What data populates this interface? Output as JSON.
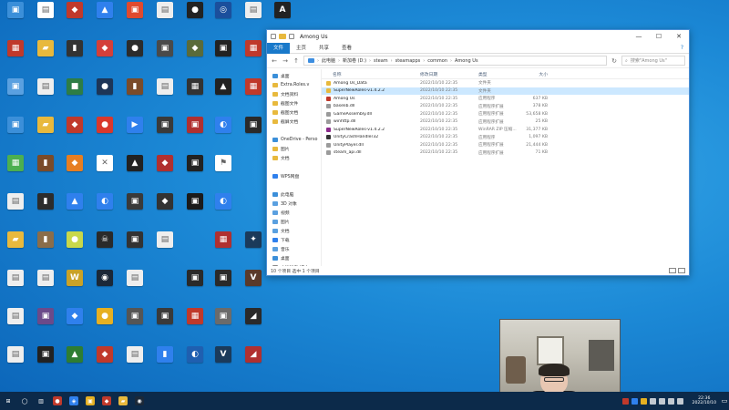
{
  "desktop": {
    "icons": [
      {
        "label": "",
        "color": "#3b8fd9",
        "glyph": "▣"
      },
      {
        "label": "",
        "color": "#ffffff",
        "glyph": "▤"
      },
      {
        "label": "",
        "color": "#c0392b",
        "glyph": "◆"
      },
      {
        "label": "",
        "color": "#2f80ed",
        "glyph": "▲"
      },
      {
        "label": "",
        "color": "#e04a2f",
        "glyph": "▣"
      },
      {
        "label": "",
        "color": "#eeeeee",
        "glyph": "▤"
      },
      {
        "label": "",
        "color": "#222222",
        "glyph": "●"
      },
      {
        "label": "",
        "color": "#1b4f9c",
        "glyph": "◎"
      },
      {
        "label": "",
        "color": "#eeeeee",
        "glyph": "▤"
      },
      {
        "label": "",
        "color": "#222222",
        "glyph": "A"
      },
      {
        "label": "",
        "color": "#c0392b",
        "glyph": "▦"
      },
      {
        "label": "",
        "color": "#e8b93d",
        "glyph": "▰"
      },
      {
        "label": "",
        "color": "#333333",
        "glyph": "▮"
      },
      {
        "label": "",
        "color": "#d43f3a",
        "glyph": "◆"
      },
      {
        "label": "",
        "color": "#2c2c2c",
        "glyph": "●"
      },
      {
        "label": "",
        "color": "#4a4a4a",
        "glyph": "▣"
      },
      {
        "label": "",
        "color": "#5a6b3a",
        "glyph": "◆"
      },
      {
        "label": "",
        "color": "#222222",
        "glyph": "▣"
      },
      {
        "label": "",
        "color": "#c0392b",
        "glyph": "▦"
      },
      {
        "label": "",
        "color": "#555555",
        "glyph": "▣"
      },
      {
        "label": "",
        "color": "#5aa0e0",
        "glyph": "▣"
      },
      {
        "label": "",
        "color": "#eeeeee",
        "glyph": "▤"
      },
      {
        "label": "",
        "color": "#2d7d46",
        "glyph": "■"
      },
      {
        "label": "",
        "color": "#1d3557",
        "glyph": "●"
      },
      {
        "label": "",
        "color": "#7a4b2a",
        "glyph": "▮"
      },
      {
        "label": "",
        "color": "#eeeeee",
        "glyph": "▤"
      },
      {
        "label": "",
        "color": "#333333",
        "glyph": "▦"
      },
      {
        "label": "",
        "color": "#222222",
        "glyph": "▲"
      },
      {
        "label": "",
        "color": "#c0392b",
        "glyph": "▦"
      },
      {
        "label": "",
        "color": "#eeeeee",
        "glyph": "▤"
      },
      {
        "label": "",
        "color": "#3b8fd9",
        "glyph": "▣"
      },
      {
        "label": "",
        "color": "#e8b93d",
        "glyph": "▰"
      },
      {
        "label": "",
        "color": "#c0392b",
        "glyph": "◆"
      },
      {
        "label": "",
        "color": "#d9382c",
        "glyph": "●"
      },
      {
        "label": "",
        "color": "#2f80ed",
        "glyph": "▶"
      },
      {
        "label": "",
        "color": "#3a3a3a",
        "glyph": "▣"
      },
      {
        "label": "",
        "color": "#b03030",
        "glyph": "▣"
      },
      {
        "label": "",
        "color": "#2f80ed",
        "glyph": "◐"
      },
      {
        "label": "",
        "color": "#2a2a2a",
        "glyph": "▣"
      },
      {
        "label": "",
        "color": "#4caf50",
        "glyph": "▦"
      },
      {
        "label": "",
        "color": "#7a4b2a",
        "glyph": "▮"
      },
      {
        "label": "",
        "color": "#e67e22",
        "glyph": "◆"
      },
      {
        "label": "",
        "color": "#ffffff",
        "glyph": "✕"
      },
      {
        "label": "",
        "color": "#222222",
        "glyph": "▲"
      },
      {
        "label": "",
        "color": "#b03030",
        "glyph": "◆"
      },
      {
        "label": "",
        "color": "#222222",
        "glyph": "▣"
      },
      {
        "label": "",
        "color": "#ffffff",
        "glyph": "⚑"
      },
      {
        "label": "",
        "color": "#1f5fb0",
        "glyph": "▶"
      },
      {
        "label": "",
        "color": "#eeeeee",
        "glyph": "▤"
      },
      {
        "label": "",
        "color": "#2c2c2c",
        "glyph": "▮"
      },
      {
        "label": "",
        "color": "#2f80ed",
        "glyph": "▲"
      },
      {
        "label": "",
        "color": "#2f80ed",
        "glyph": "◐"
      },
      {
        "label": "",
        "color": "#3a3a3a",
        "glyph": "▣"
      },
      {
        "label": "",
        "color": "#333333",
        "glyph": "◆"
      },
      {
        "label": "",
        "color": "#1b1b1b",
        "glyph": "▣"
      },
      {
        "label": "",
        "color": "#2f80ed",
        "glyph": "◐"
      },
      {
        "label": "",
        "color": "#222222",
        "glyph": "♪"
      },
      {
        "label": "",
        "color": "#e8b93d",
        "glyph": "▰"
      },
      {
        "label": "",
        "color": "#8a6d4a",
        "glyph": "▮"
      },
      {
        "label": "",
        "color": "#c8d84a",
        "glyph": "●"
      },
      {
        "label": "",
        "color": "#2a2a2a",
        "glyph": "☠"
      },
      {
        "label": "",
        "color": "#333333",
        "glyph": "▣"
      },
      {
        "label": "",
        "color": "#eeeeee",
        "glyph": "▤"
      },
      {
        "label": "",
        "color": "#b03030",
        "glyph": "▦"
      },
      {
        "label": "",
        "color": "#1b3a5a",
        "glyph": "✦"
      },
      {
        "label": "",
        "color": "#eeeeee",
        "glyph": "▤"
      },
      {
        "label": "",
        "color": "#eeeeee",
        "glyph": "▤"
      },
      {
        "label": "",
        "color": "#c9a227",
        "glyph": "W"
      },
      {
        "label": "",
        "color": "#1b2838",
        "glyph": "◉"
      },
      {
        "label": "",
        "color": "#eeeeee",
        "glyph": "▤"
      },
      {
        "label": "",
        "color": "#2a2a2a",
        "glyph": "▣"
      },
      {
        "label": "",
        "color": "#2a2a2a",
        "glyph": "▣"
      },
      {
        "label": "",
        "color": "#5a3a2a",
        "glyph": "V"
      },
      {
        "label": "",
        "color": "#eeeeee",
        "glyph": "▤"
      },
      {
        "label": "",
        "color": "#6b4a8a",
        "glyph": "▣"
      },
      {
        "label": "",
        "color": "#2f80ed",
        "glyph": "◆"
      },
      {
        "label": "",
        "color": "#e6b022",
        "glyph": "●"
      },
      {
        "label": "",
        "color": "#555555",
        "glyph": "▣"
      },
      {
        "label": "",
        "color": "#3a3a3a",
        "glyph": "▣"
      },
      {
        "label": "",
        "color": "#c0392b",
        "glyph": "▦"
      },
      {
        "label": "",
        "color": "#6b6b6b",
        "glyph": "▣"
      },
      {
        "label": "",
        "color": "#2a2a2a",
        "glyph": "◢"
      },
      {
        "label": "",
        "color": "#eeeeee",
        "glyph": "▤"
      },
      {
        "label": "",
        "color": "#222222",
        "glyph": "▣"
      },
      {
        "label": "",
        "color": "#2e7d32",
        "glyph": "▲"
      },
      {
        "label": "",
        "color": "#c0392b",
        "glyph": "◆"
      },
      {
        "label": "",
        "color": "#eeeeee",
        "glyph": "▤"
      },
      {
        "label": "",
        "color": "#2f80ed",
        "glyph": "▮"
      },
      {
        "label": "",
        "color": "#1f5fb0",
        "glyph": "◐"
      },
      {
        "label": "",
        "color": "#1b3a5a",
        "glyph": "V"
      },
      {
        "label": "",
        "color": "#b03030",
        "glyph": "◢"
      }
    ]
  },
  "explorer": {
    "title": "Among Us",
    "controls": {
      "minimize": "—",
      "maximize": "☐",
      "close": "✕"
    },
    "ribbon": {
      "tabs": [
        {
          "label": "文件",
          "active": true
        },
        {
          "label": "主页",
          "active": false
        },
        {
          "label": "共享",
          "active": false
        },
        {
          "label": "查看",
          "active": false
        }
      ],
      "help": "?"
    },
    "address": {
      "back": "←",
      "forward": "→",
      "up": "↑",
      "crumbs": [
        "此电脑",
        "新加卷 (D:)",
        "steam",
        "steamapps",
        "common",
        "Among Us"
      ],
      "refresh": "↻",
      "search_placeholder": "搜索\"Among Us\""
    },
    "navpane": [
      {
        "label": "桌面",
        "color": "#3b8fd9",
        "selected": false
      },
      {
        "label": "Extra.Roles.v",
        "color": "#e8b93d",
        "selected": false
      },
      {
        "label": "文档资料",
        "color": "#e8b93d",
        "selected": false
      },
      {
        "label": "截图文件",
        "color": "#e8b93d",
        "selected": false
      },
      {
        "label": "截图文档",
        "color": "#e8b93d",
        "selected": false
      },
      {
        "label": "截屏文档",
        "color": "#e8b93d",
        "selected": false
      },
      {
        "label": "",
        "color": "#ffffff",
        "selected": false
      },
      {
        "label": "OneDrive - Perso",
        "color": "#3b8fd9",
        "selected": false
      },
      {
        "label": "图片",
        "color": "#e8b93d",
        "selected": false
      },
      {
        "label": "文档",
        "color": "#e8b93d",
        "selected": false
      },
      {
        "label": "",
        "color": "#ffffff",
        "selected": false
      },
      {
        "label": "WPS网盘",
        "color": "#2f80ed",
        "selected": false
      },
      {
        "label": "",
        "color": "#ffffff",
        "selected": false
      },
      {
        "label": "此电脑",
        "color": "#3b8fd9",
        "selected": false
      },
      {
        "label": "3D 对象",
        "color": "#5aa0e0",
        "selected": false
      },
      {
        "label": "视频",
        "color": "#5aa0e0",
        "selected": false
      },
      {
        "label": "图片",
        "color": "#5aa0e0",
        "selected": false
      },
      {
        "label": "文档",
        "color": "#5aa0e0",
        "selected": false
      },
      {
        "label": "下载",
        "color": "#2f80ed",
        "selected": false
      },
      {
        "label": "音乐",
        "color": "#5aa0e0",
        "selected": false
      },
      {
        "label": "桌面",
        "color": "#3b8fd9",
        "selected": false
      },
      {
        "label": "本地磁盘 (C:)",
        "color": "#888888",
        "selected": false
      },
      {
        "label": "新加卷 (D:)",
        "color": "#888888",
        "selected": true
      }
    ],
    "columns": {
      "name": "名称",
      "date": "修改日期",
      "type": "类型",
      "size": "大小"
    },
    "files": [
      {
        "name": "Among Us_Data",
        "date": "2022/10/10 22:35",
        "type": "文件夹",
        "size": "",
        "color": "#e8b93d",
        "selected": false
      },
      {
        "name": "SuperNewRoles-v1.4.2.2",
        "date": "2022/10/10 22:35",
        "type": "文件夹",
        "size": "",
        "color": "#e8b93d",
        "selected": true
      },
      {
        "name": "Among Us",
        "date": "2022/10/10 22:35",
        "type": "应用程序",
        "size": "637 KB",
        "color": "#c0392b",
        "selected": false
      },
      {
        "name": "baselib.dll",
        "date": "2022/10/10 22:35",
        "type": "应用程序扩展",
        "size": "378 KB",
        "color": "#9a9a9a",
        "selected": false
      },
      {
        "name": "GameAssembly.dll",
        "date": "2022/10/10 22:35",
        "type": "应用程序扩展",
        "size": "53,658 KB",
        "color": "#9a9a9a",
        "selected": false
      },
      {
        "name": "winhttp.dll",
        "date": "2022/10/10 22:35",
        "type": "应用程序扩展",
        "size": "25 KB",
        "color": "#9a9a9a",
        "selected": false
      },
      {
        "name": "SuperNewRoles-v1.4.2.2",
        "date": "2022/10/10 22:35",
        "type": "WinRAR ZIP 压缩...",
        "size": "31,377 KB",
        "color": "#8b2a8b",
        "selected": false
      },
      {
        "name": "UnityCrashHandler32",
        "date": "2022/10/10 22:35",
        "type": "应用程序",
        "size": "1,097 KB",
        "color": "#333333",
        "selected": false
      },
      {
        "name": "UnityPlayer.dll",
        "date": "2022/10/10 22:35",
        "type": "应用程序扩展",
        "size": "21,444 KB",
        "color": "#9a9a9a",
        "selected": false
      },
      {
        "name": "steam_api.dll",
        "date": "2022/10/10 22:35",
        "type": "应用程序扩展",
        "size": "71 KB",
        "color": "#9a9a9a",
        "selected": false
      }
    ],
    "status": "10 个项目    选中 1 个项目"
  },
  "taskbar": {
    "buttons": [
      {
        "name": "start",
        "glyph": "⊞",
        "color": "#0c2a4a"
      },
      {
        "name": "search",
        "glyph": "◯",
        "color": "#0c2a4a"
      },
      {
        "name": "taskview",
        "glyph": "▥",
        "color": "#0c2a4a"
      },
      {
        "name": "app-1",
        "glyph": "●",
        "color": "#c0392b"
      },
      {
        "name": "app-2",
        "glyph": "◈",
        "color": "#2f80ed"
      },
      {
        "name": "app-3",
        "glyph": "▣",
        "color": "#e6b022"
      },
      {
        "name": "app-4",
        "glyph": "◆",
        "color": "#c0392b"
      },
      {
        "name": "app-5",
        "glyph": "▰",
        "color": "#e8b93d"
      },
      {
        "name": "app-6",
        "glyph": "◉",
        "color": "#1b2838"
      }
    ],
    "clock": {
      "time": "22:36",
      "date": "2022/10/10"
    },
    "notify": "▭",
    "tray_colors": [
      "#c0392b",
      "#2f80ed",
      "#e6b022",
      "#ffffff",
      "#ffffff",
      "#ffffff",
      "#ffffff"
    ]
  }
}
